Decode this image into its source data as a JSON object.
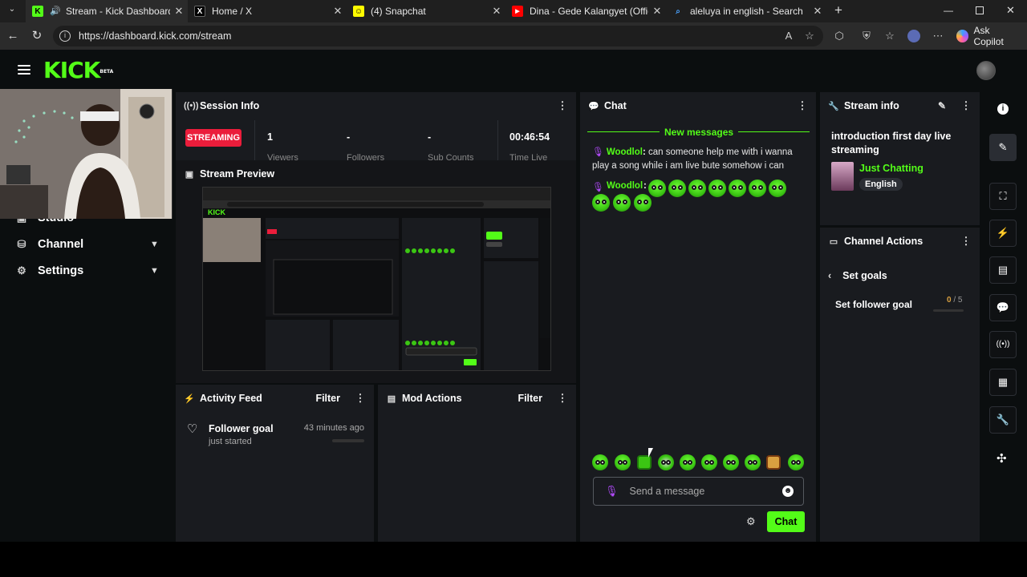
{
  "browser": {
    "tabs": [
      {
        "title": "Stream - Kick Dashboard",
        "active": true
      },
      {
        "title": "Home / X",
        "active": false
      },
      {
        "title": "(4) Snapchat",
        "active": false
      },
      {
        "title": "Dina - Gede Kalangyet (Official Vi",
        "active": false
      },
      {
        "title": "aleluya in english - Search",
        "active": false
      }
    ],
    "url": "https://dashboard.kick.com/stream",
    "copilot_label": "Ask Copilot"
  },
  "kick": {
    "logo": "KICK",
    "beta": "BETA",
    "nav": [
      {
        "label": "Studio",
        "icon": "studio-icon"
      },
      {
        "label": "Channel",
        "icon": "channel-icon"
      },
      {
        "label": "Settings",
        "icon": "gear-icon"
      }
    ]
  },
  "session": {
    "title": "Session Info",
    "status": "STREAMING",
    "stats": [
      {
        "value": "1",
        "label": "Viewers"
      },
      {
        "value": "-",
        "label": "Followers"
      },
      {
        "value": "-",
        "label": "Sub Counts"
      },
      {
        "value": "00:46:54",
        "label": "Time Live"
      }
    ]
  },
  "preview": {
    "title": "Stream Preview"
  },
  "activity": {
    "title": "Activity Feed",
    "filter": "Filter",
    "item_title": "Follower goal",
    "item_sub": "just started",
    "item_time": "43 minutes ago"
  },
  "mod": {
    "title": "Mod Actions",
    "filter": "Filter"
  },
  "chat": {
    "title": "Chat",
    "new_messages": "New messages",
    "messages": [
      {
        "user": "Woodlol",
        "text": "can someone help me with i wanna play a song while i am live bute somehow i can"
      },
      {
        "user": "Woodlol",
        "text": ""
      }
    ],
    "placeholder": "Send a message",
    "send": "Chat"
  },
  "stream_info": {
    "title": "Stream info",
    "stream_title": "introduction first day live streaming",
    "category": "Just Chatting",
    "language": "English"
  },
  "channel_actions": {
    "title": "Channel Actions",
    "back_label": "Set goals",
    "goal_label": "Set follower goal",
    "goal_current": "0",
    "goal_target": "/ 5",
    "goal_progress": 0
  },
  "colors": {
    "accent": "#53fc18",
    "live": "#eb1d3b",
    "panel": "#191b1f"
  }
}
